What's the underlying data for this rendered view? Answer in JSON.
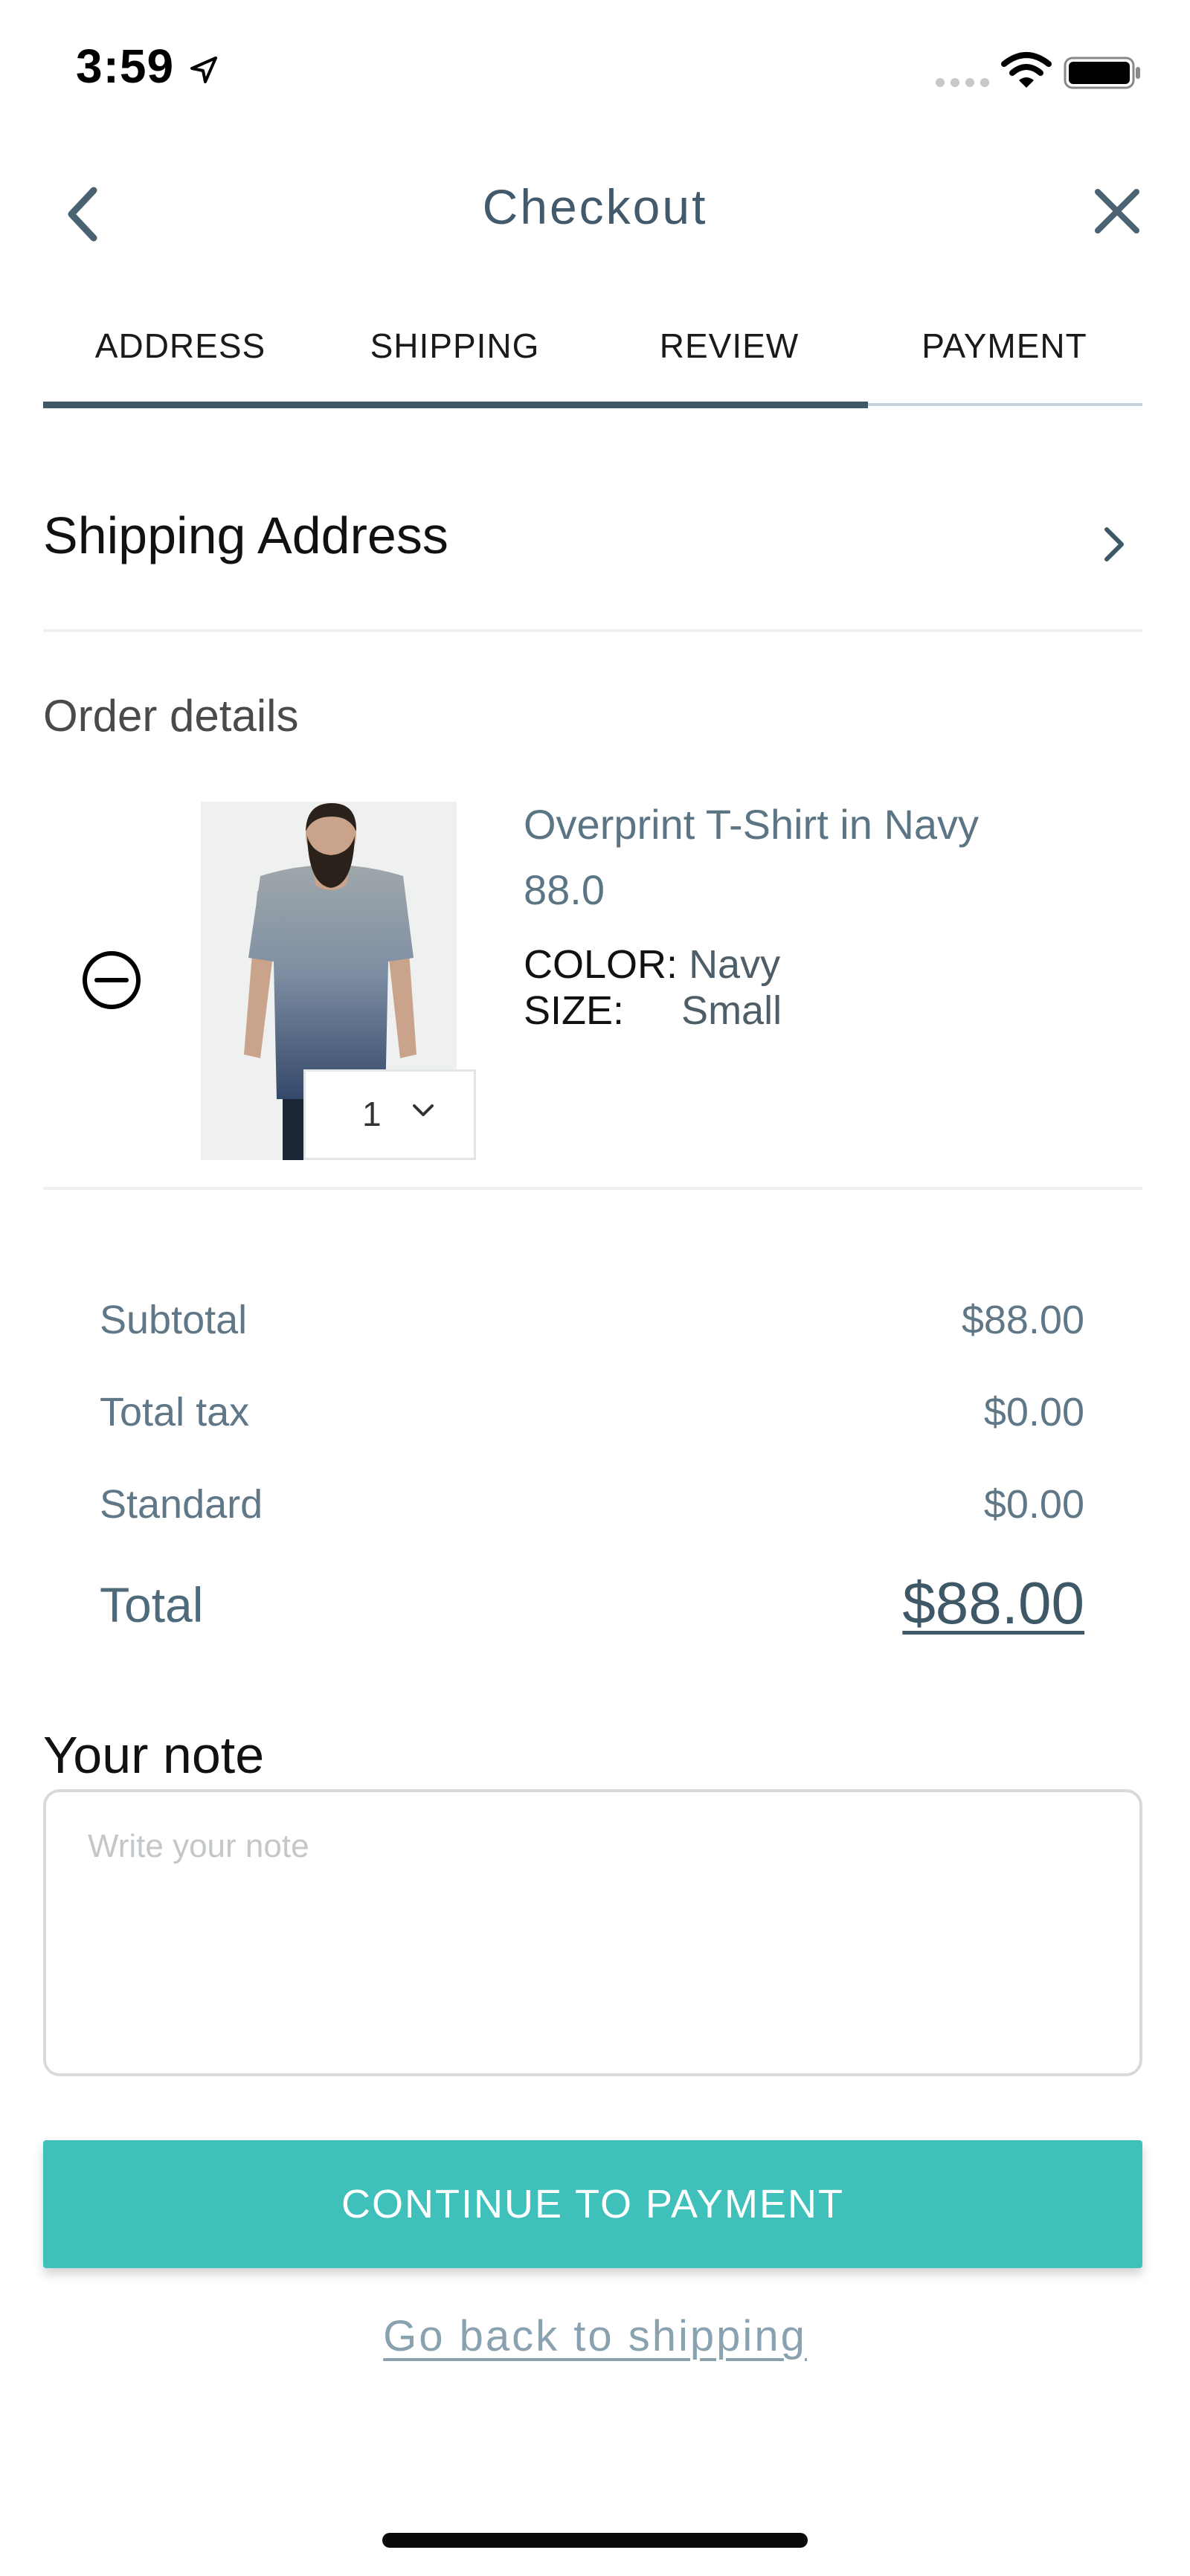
{
  "status_bar": {
    "time": "3:59"
  },
  "header": {
    "title": "Checkout"
  },
  "tabs": [
    {
      "label": "ADDRESS"
    },
    {
      "label": "SHIPPING"
    },
    {
      "label": "REVIEW"
    },
    {
      "label": "PAYMENT"
    }
  ],
  "checkout_progress": 0.75,
  "shipping_section": {
    "title": "Shipping Address"
  },
  "order": {
    "heading": "Order details",
    "item": {
      "name": "Overprint T-Shirt in Navy",
      "price": "88.0",
      "color_label": "COLOR:",
      "color_value": "Navy",
      "size_label": "SIZE:",
      "size_value": "Small",
      "quantity": "1"
    }
  },
  "totals": {
    "subtotal_label": "Subtotal",
    "subtotal_value": "$88.00",
    "tax_label": "Total tax",
    "tax_value": "$0.00",
    "shipping_label": "Standard",
    "shipping_value": "$0.00",
    "total_label": "Total",
    "total_value": "$88.00"
  },
  "note": {
    "heading": "Your note",
    "placeholder": "Write your note",
    "value": ""
  },
  "actions": {
    "continue_label": "CONTINUE TO PAYMENT",
    "back_label": "Go back to shipping"
  },
  "colors": {
    "accent": "#3fc0ba",
    "primary_text": "#3e5868",
    "muted_text": "#5f7786",
    "link": "#8aa2b0"
  }
}
